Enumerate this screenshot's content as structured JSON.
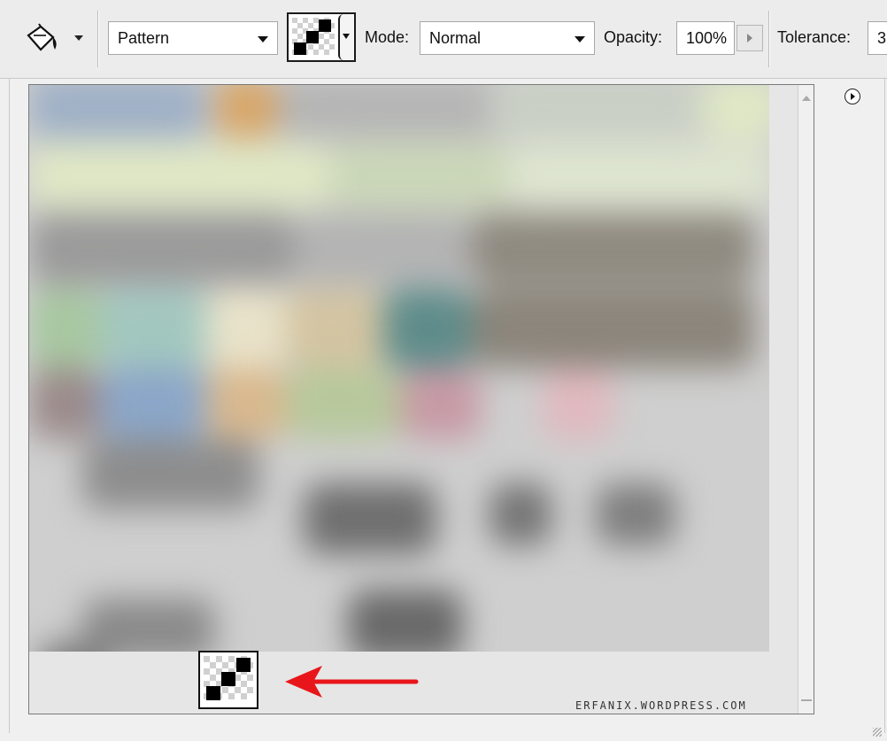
{
  "toolbar": {
    "tool_icon": "paint-bucket-icon",
    "fill_source": "Pattern",
    "mode_label": "Mode:",
    "mode_value": "Normal",
    "opacity_label": "Opacity:",
    "opacity_value": "100%",
    "tolerance_label": "Tolerance:",
    "tolerance_value": "3"
  },
  "pattern_panel": {
    "menu_icon": "panel-menu-arrow-icon",
    "selected_pattern_icon": "checkerboard-pattern-icon",
    "annotation_arrow_color": "#e8161b",
    "watermark": "ERFANIX.WORDPRESS.COM"
  }
}
